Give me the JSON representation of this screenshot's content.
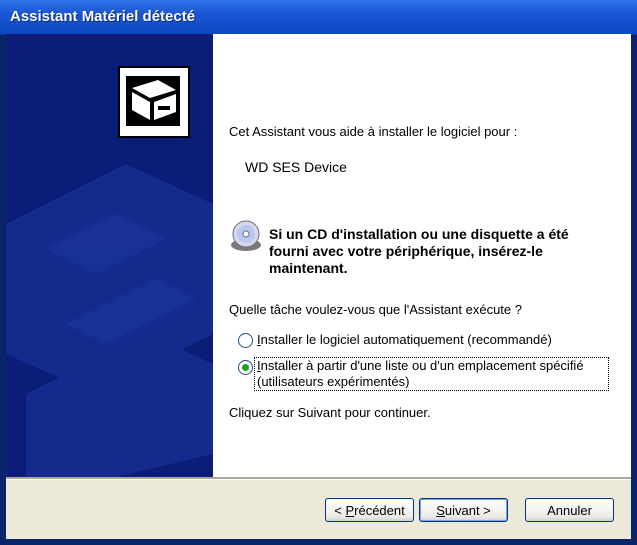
{
  "window": {
    "title": "Assistant Matériel détecté"
  },
  "content": {
    "intro": "Cet Assistant vous aide à installer le logiciel pour :",
    "device_name": "WD SES Device",
    "cd_prompt_line1": "Si un CD d'installation ou une disquette a été",
    "cd_prompt_line2": "fourni avec votre périphérique, insérez-le",
    "cd_prompt_line3": "maintenant.",
    "question": "Quelle tâche voulez-vous que l'Assistant exécute ?",
    "options": [
      {
        "label_first": "I",
        "label_rest": "nstaller le logiciel automatiquement (recommandé)",
        "selected": false
      },
      {
        "label_first": "I",
        "label_rest": "nstaller à partir d'une liste ou d'un emplacement spécifié",
        "label_line2": "(utilisateurs expérimentés)",
        "selected": true
      }
    ],
    "continue_hint": "Cliquez sur Suivant pour continuer."
  },
  "buttons": {
    "back_prefix": "< ",
    "back_accel": "P",
    "back_rest": "récédent",
    "next_accel": "S",
    "next_rest": "uivant >",
    "cancel": "Annuler"
  },
  "icons": [
    "hardware-wizard-icon",
    "cd-disk-icon"
  ],
  "colors": {
    "titlebar": "#0d47c4",
    "left_panel": "#0b1d77",
    "dialog_bg": "#ece9d8",
    "radio_selected": "#21a121"
  }
}
